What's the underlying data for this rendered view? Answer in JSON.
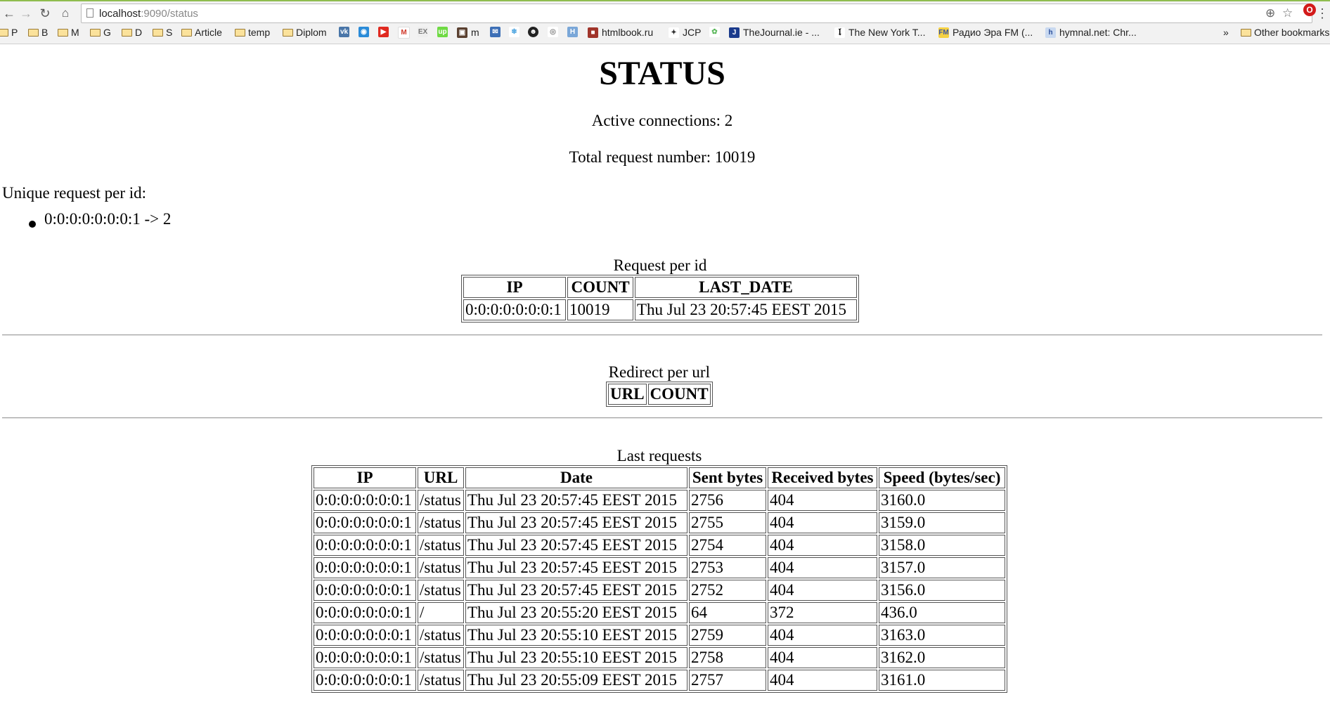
{
  "browser": {
    "url_host": "localhost",
    "url_rest": ":9090/status",
    "bookmarks": [
      {
        "label": "P",
        "type": "folder"
      },
      {
        "label": "B",
        "type": "folder"
      },
      {
        "label": "M",
        "type": "folder"
      },
      {
        "label": "G",
        "type": "folder"
      },
      {
        "label": "D",
        "type": "folder"
      },
      {
        "label": "S",
        "type": "folder"
      },
      {
        "label": "Article",
        "type": "folder"
      },
      {
        "label": "temp",
        "type": "folder"
      },
      {
        "label": "Diplom",
        "type": "folder"
      },
      {
        "label": "m",
        "type": "site"
      },
      {
        "label": "htmlbook.ru",
        "type": "site"
      },
      {
        "label": "JCP",
        "type": "site"
      },
      {
        "label": "TheJournal.ie - ...",
        "type": "site"
      },
      {
        "label": "The New York T...",
        "type": "site"
      },
      {
        "label": "Радио Эра FM (...",
        "type": "site"
      },
      {
        "label": "hymnal.net: Chr...",
        "type": "site"
      },
      {
        "label": "»",
        "type": "overflow"
      },
      {
        "label": "Other bookmarks",
        "type": "folder"
      }
    ]
  },
  "page": {
    "title": "STATUS",
    "active_connections": "Active connections: 2",
    "total_requests": "Total request number: 10019",
    "unique_heading": "Unique request per id:",
    "unique_items": [
      "0:0:0:0:0:0:0:1 -> 2"
    ],
    "request_per_id": {
      "caption": "Request per id",
      "headers": [
        "IP",
        "COUNT",
        "LAST_DATE"
      ],
      "rows": [
        [
          "0:0:0:0:0:0:0:1",
          "10019",
          "Thu Jul 23 20:57:45 EEST 2015"
        ]
      ]
    },
    "redirect_per_url": {
      "caption": "Redirect per url",
      "headers": [
        "URL",
        "COUNT"
      ]
    },
    "last_requests": {
      "caption": "Last requests",
      "headers": [
        "IP",
        "URL",
        "Date",
        "Sent bytes",
        "Received bytes",
        "Speed (bytes/sec)"
      ],
      "rows": [
        [
          "0:0:0:0:0:0:0:1",
          "/status",
          "Thu Jul 23 20:57:45 EEST 2015",
          "2756",
          "404",
          "3160.0"
        ],
        [
          "0:0:0:0:0:0:0:1",
          "/status",
          "Thu Jul 23 20:57:45 EEST 2015",
          "2755",
          "404",
          "3159.0"
        ],
        [
          "0:0:0:0:0:0:0:1",
          "/status",
          "Thu Jul 23 20:57:45 EEST 2015",
          "2754",
          "404",
          "3158.0"
        ],
        [
          "0:0:0:0:0:0:0:1",
          "/status",
          "Thu Jul 23 20:57:45 EEST 2015",
          "2753",
          "404",
          "3157.0"
        ],
        [
          "0:0:0:0:0:0:0:1",
          "/status",
          "Thu Jul 23 20:57:45 EEST 2015",
          "2752",
          "404",
          "3156.0"
        ],
        [
          "0:0:0:0:0:0:0:1",
          "/",
          "Thu Jul 23 20:55:20 EEST 2015",
          "64",
          "372",
          "436.0"
        ],
        [
          "0:0:0:0:0:0:0:1",
          "/status",
          "Thu Jul 23 20:55:10 EEST 2015",
          "2759",
          "404",
          "3163.0"
        ],
        [
          "0:0:0:0:0:0:0:1",
          "/status",
          "Thu Jul 23 20:55:10 EEST 2015",
          "2758",
          "404",
          "3162.0"
        ],
        [
          "0:0:0:0:0:0:0:1",
          "/status",
          "Thu Jul 23 20:55:09 EEST 2015",
          "2757",
          "404",
          "3161.0"
        ]
      ]
    }
  }
}
